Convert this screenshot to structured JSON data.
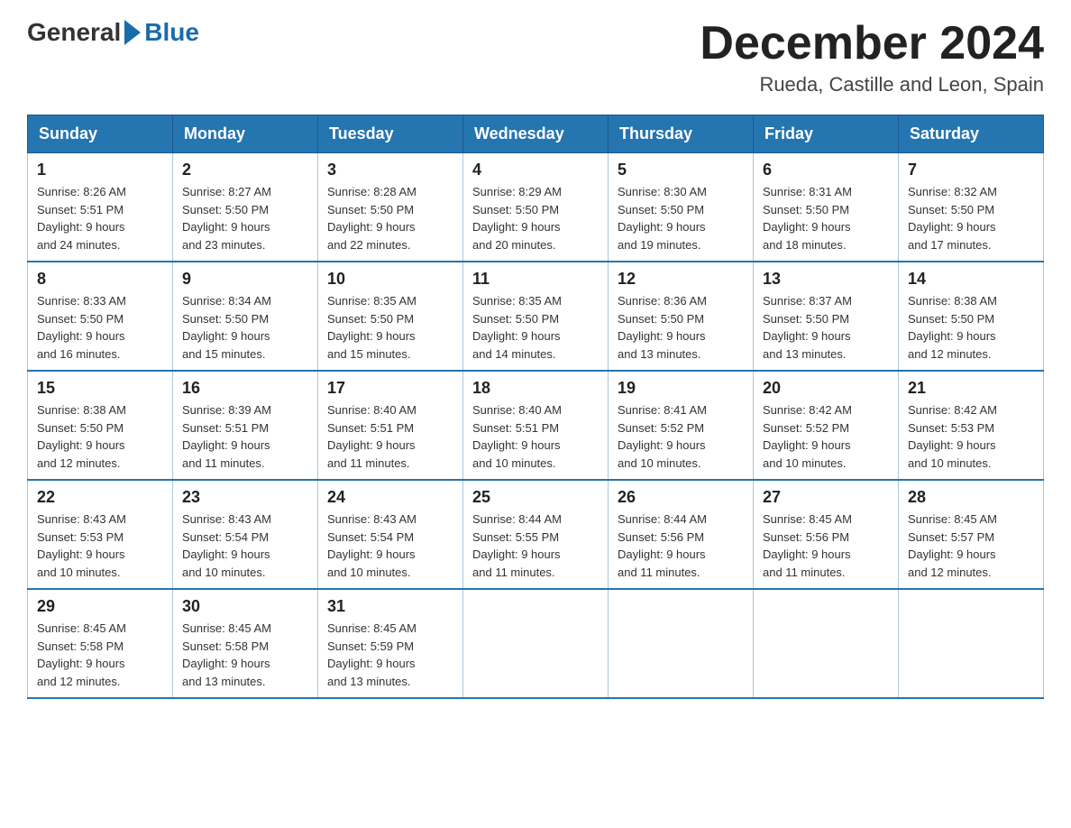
{
  "logo": {
    "general": "General",
    "blue": "Blue"
  },
  "title": "December 2024",
  "subtitle": "Rueda, Castille and Leon, Spain",
  "days_header": [
    "Sunday",
    "Monday",
    "Tuesday",
    "Wednesday",
    "Thursday",
    "Friday",
    "Saturday"
  ],
  "weeks": [
    [
      {
        "day": "1",
        "sunrise": "8:26 AM",
        "sunset": "5:51 PM",
        "daylight": "9 hours and 24 minutes."
      },
      {
        "day": "2",
        "sunrise": "8:27 AM",
        "sunset": "5:50 PM",
        "daylight": "9 hours and 23 minutes."
      },
      {
        "day": "3",
        "sunrise": "8:28 AM",
        "sunset": "5:50 PM",
        "daylight": "9 hours and 22 minutes."
      },
      {
        "day": "4",
        "sunrise": "8:29 AM",
        "sunset": "5:50 PM",
        "daylight": "9 hours and 20 minutes."
      },
      {
        "day": "5",
        "sunrise": "8:30 AM",
        "sunset": "5:50 PM",
        "daylight": "9 hours and 19 minutes."
      },
      {
        "day": "6",
        "sunrise": "8:31 AM",
        "sunset": "5:50 PM",
        "daylight": "9 hours and 18 minutes."
      },
      {
        "day": "7",
        "sunrise": "8:32 AM",
        "sunset": "5:50 PM",
        "daylight": "9 hours and 17 minutes."
      }
    ],
    [
      {
        "day": "8",
        "sunrise": "8:33 AM",
        "sunset": "5:50 PM",
        "daylight": "9 hours and 16 minutes."
      },
      {
        "day": "9",
        "sunrise": "8:34 AM",
        "sunset": "5:50 PM",
        "daylight": "9 hours and 15 minutes."
      },
      {
        "day": "10",
        "sunrise": "8:35 AM",
        "sunset": "5:50 PM",
        "daylight": "9 hours and 15 minutes."
      },
      {
        "day": "11",
        "sunrise": "8:35 AM",
        "sunset": "5:50 PM",
        "daylight": "9 hours and 14 minutes."
      },
      {
        "day": "12",
        "sunrise": "8:36 AM",
        "sunset": "5:50 PM",
        "daylight": "9 hours and 13 minutes."
      },
      {
        "day": "13",
        "sunrise": "8:37 AM",
        "sunset": "5:50 PM",
        "daylight": "9 hours and 13 minutes."
      },
      {
        "day": "14",
        "sunrise": "8:38 AM",
        "sunset": "5:50 PM",
        "daylight": "9 hours and 12 minutes."
      }
    ],
    [
      {
        "day": "15",
        "sunrise": "8:38 AM",
        "sunset": "5:50 PM",
        "daylight": "9 hours and 12 minutes."
      },
      {
        "day": "16",
        "sunrise": "8:39 AM",
        "sunset": "5:51 PM",
        "daylight": "9 hours and 11 minutes."
      },
      {
        "day": "17",
        "sunrise": "8:40 AM",
        "sunset": "5:51 PM",
        "daylight": "9 hours and 11 minutes."
      },
      {
        "day": "18",
        "sunrise": "8:40 AM",
        "sunset": "5:51 PM",
        "daylight": "9 hours and 10 minutes."
      },
      {
        "day": "19",
        "sunrise": "8:41 AM",
        "sunset": "5:52 PM",
        "daylight": "9 hours and 10 minutes."
      },
      {
        "day": "20",
        "sunrise": "8:42 AM",
        "sunset": "5:52 PM",
        "daylight": "9 hours and 10 minutes."
      },
      {
        "day": "21",
        "sunrise": "8:42 AM",
        "sunset": "5:53 PM",
        "daylight": "9 hours and 10 minutes."
      }
    ],
    [
      {
        "day": "22",
        "sunrise": "8:43 AM",
        "sunset": "5:53 PM",
        "daylight": "9 hours and 10 minutes."
      },
      {
        "day": "23",
        "sunrise": "8:43 AM",
        "sunset": "5:54 PM",
        "daylight": "9 hours and 10 minutes."
      },
      {
        "day": "24",
        "sunrise": "8:43 AM",
        "sunset": "5:54 PM",
        "daylight": "9 hours and 10 minutes."
      },
      {
        "day": "25",
        "sunrise": "8:44 AM",
        "sunset": "5:55 PM",
        "daylight": "9 hours and 11 minutes."
      },
      {
        "day": "26",
        "sunrise": "8:44 AM",
        "sunset": "5:56 PM",
        "daylight": "9 hours and 11 minutes."
      },
      {
        "day": "27",
        "sunrise": "8:45 AM",
        "sunset": "5:56 PM",
        "daylight": "9 hours and 11 minutes."
      },
      {
        "day": "28",
        "sunrise": "8:45 AM",
        "sunset": "5:57 PM",
        "daylight": "9 hours and 12 minutes."
      }
    ],
    [
      {
        "day": "29",
        "sunrise": "8:45 AM",
        "sunset": "5:58 PM",
        "daylight": "9 hours and 12 minutes."
      },
      {
        "day": "30",
        "sunrise": "8:45 AM",
        "sunset": "5:58 PM",
        "daylight": "9 hours and 13 minutes."
      },
      {
        "day": "31",
        "sunrise": "8:45 AM",
        "sunset": "5:59 PM",
        "daylight": "9 hours and 13 minutes."
      },
      null,
      null,
      null,
      null
    ]
  ],
  "sunrise_label": "Sunrise:",
  "sunset_label": "Sunset:",
  "daylight_label": "Daylight:"
}
